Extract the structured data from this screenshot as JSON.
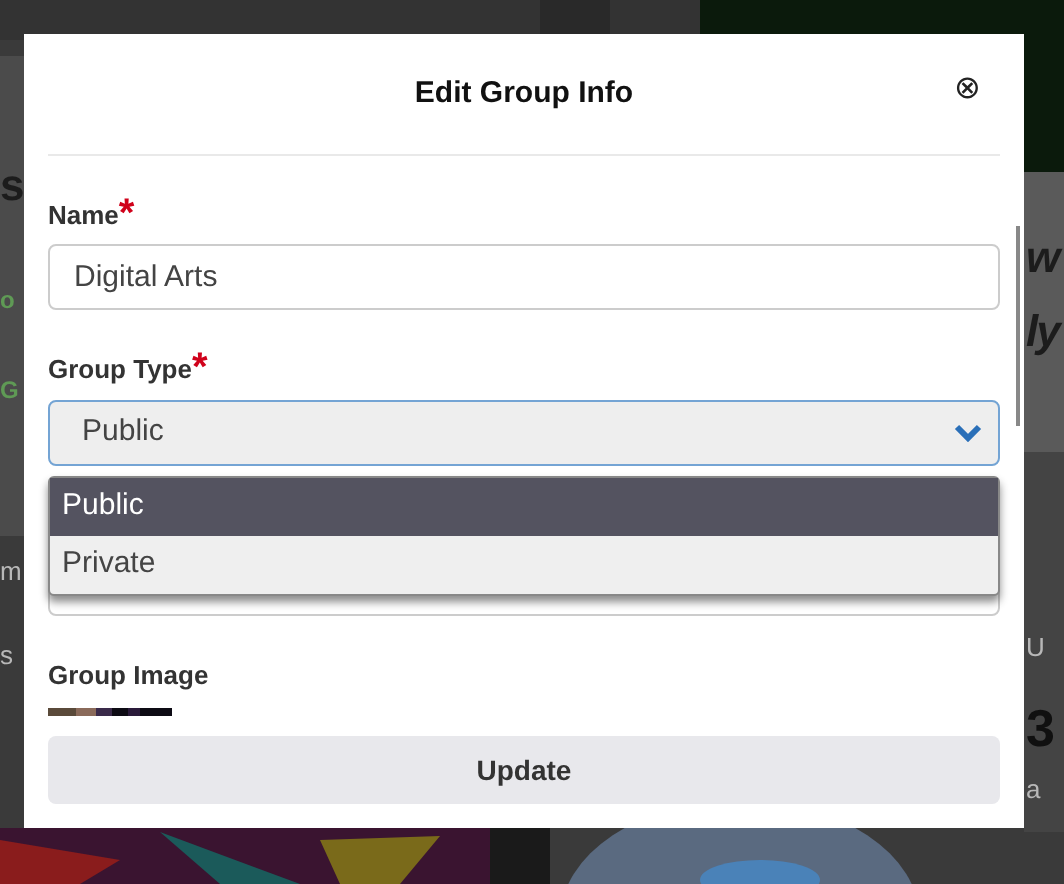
{
  "background_page": {
    "left_fragments": [
      {
        "text": "s",
        "kind": "heading"
      },
      {
        "text": "o",
        "kind": "accent"
      },
      {
        "text": "G",
        "kind": "accent"
      },
      {
        "text": "m",
        "kind": "body"
      },
      {
        "text": "s",
        "kind": "body"
      }
    ],
    "right_fragments": [
      {
        "text": "w",
        "kind": "heading"
      },
      {
        "text": "ly",
        "kind": "heading"
      },
      {
        "text": "U",
        "kind": "body"
      },
      {
        "text": "3",
        "kind": "number"
      },
      {
        "text": "a",
        "kind": "body"
      }
    ]
  },
  "modal": {
    "title": "Edit Group Info",
    "close": "⊗",
    "fields": [
      {
        "label": "Name",
        "required": true,
        "required_mark": "*",
        "kind": "text",
        "value": "Digital Arts"
      },
      {
        "label": "Group Type",
        "required": true,
        "required_mark": "*",
        "kind": "select",
        "value": "Public",
        "expanded": true,
        "options": [
          {
            "label": "Public",
            "selected": true
          },
          {
            "label": "Private",
            "selected": false
          }
        ]
      },
      {
        "kind": "hidden_text"
      }
    ],
    "image_label": "Group Image",
    "submit": "Update"
  }
}
